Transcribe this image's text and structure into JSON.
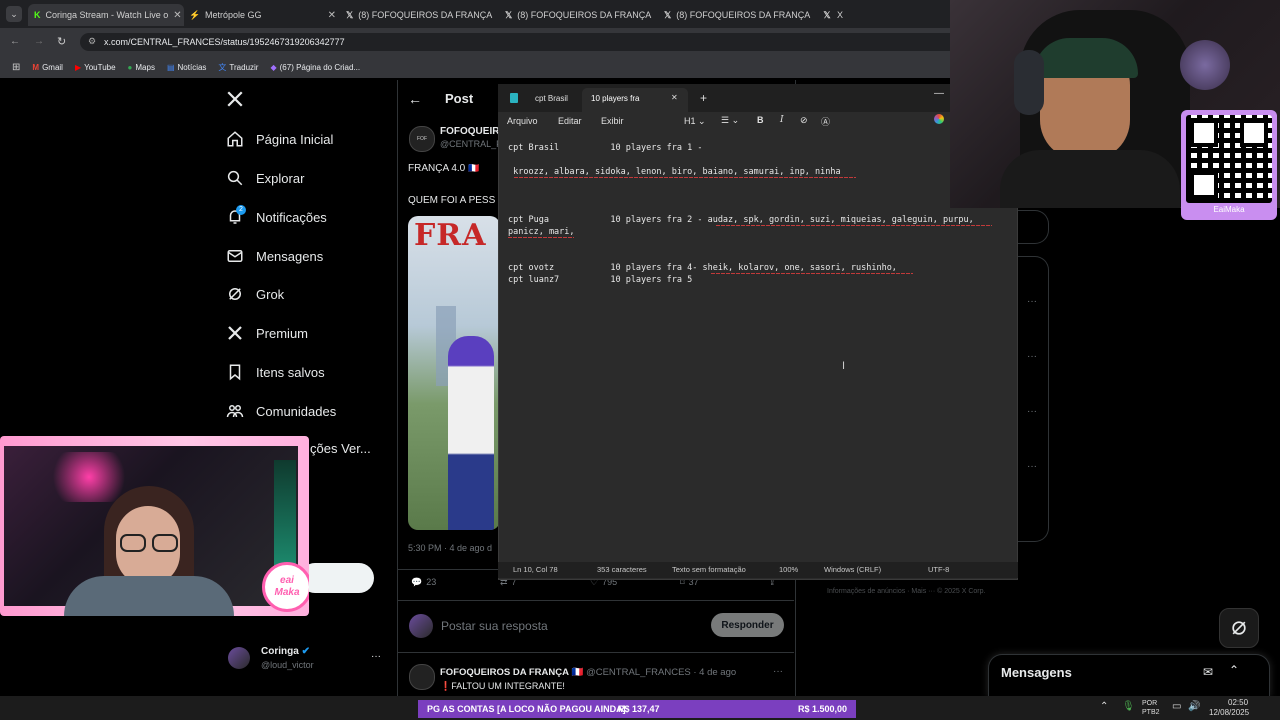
{
  "browser": {
    "tabs": [
      {
        "label": "Coringa Stream - Watch Live o",
        "fav": "K",
        "color": "#53fc18"
      },
      {
        "label": "Metrópole GG",
        "fav": "⚡",
        "color": "#ffd400"
      },
      {
        "label": "(8) FOFOQUEIROS DA FRANÇA",
        "fav": "X",
        "color": "#ffffff"
      },
      {
        "label": "(8) FOFOQUEIROS DA FRANÇA",
        "fav": "X",
        "color": "#ffffff"
      },
      {
        "label": "(8) FOFOQUEIROS DA FRANÇA",
        "fav": "X",
        "color": "#ffffff"
      },
      {
        "label": "X",
        "fav": "X",
        "color": "#ffffff"
      }
    ],
    "url": "x.com/CENTRAL_FRANCES/status/1952467319206342777",
    "bookmarks": [
      "Gmail",
      "YouTube",
      "Maps",
      "Notícias",
      "Traduzir",
      "(67) Página do Criad..."
    ]
  },
  "x": {
    "nav": [
      {
        "id": "home",
        "label": "Página Inicial"
      },
      {
        "id": "explore",
        "label": "Explorar"
      },
      {
        "id": "notifications",
        "label": "Notificações"
      },
      {
        "id": "messages",
        "label": "Mensagens"
      },
      {
        "id": "grok",
        "label": "Grok"
      },
      {
        "id": "premium",
        "label": "Premium"
      },
      {
        "id": "bookmarks",
        "label": "Itens salvos"
      },
      {
        "id": "communities",
        "label": "Comunidades"
      },
      {
        "id": "verified",
        "label": "ções Ver..."
      }
    ],
    "notif_badge": "2",
    "header": "Post",
    "author_name": "FOFOQUEIRO",
    "author_handle": "@CENTRAL_F",
    "tweet_line1": "FRANÇA 4.0",
    "tweet_line2": "QUEM FOI A PESS",
    "image_text": "FRA",
    "time": "5:30 PM · 4 de ago d",
    "stats": {
      "replies": "23",
      "retweets": "7",
      "likes": "795",
      "bookmarks": "37"
    },
    "reply_placeholder": "Postar sua resposta",
    "reply_button": "Responder",
    "account_name": "Coringa",
    "account_handle": "@loud_victor",
    "next_author": "FOFOQUEIROS DA FRANÇA",
    "next_handle": "@CENTRAL_FRANCES · 4 de ago",
    "next_text": "FALTOU UM INTEGRANTE!",
    "messages_label": "Mensagens",
    "footer": "Informações de anúncios  ·  Mais ···  © 2025 X Corp."
  },
  "notepad": {
    "tab1": "cpt Brasil",
    "tab2": "10 players fra",
    "menu": [
      "Arquivo",
      "Editar",
      "Exibir"
    ],
    "heading": "H1",
    "lines": {
      "l1": "cpt Brasil          10 players fra 1 -",
      "l2": " kroozz, albara, sidoka, lenon, biro, baiano, samurai, inp, ninha",
      "l3": "cpt Puga            10 players fra 2 - audaz, spk, gordin, suzi, miqueias, galeguin, purpu,",
      "l4": "panicz, mari,",
      "l5": "cpt ovotz           10 players fra 4- sheik, kolarov, one, sasori, rushinho,",
      "l6": "cpt luanz7          10 players fra 5"
    },
    "status": {
      "pos": "Ln 10, Col 78",
      "chars": "353 caracteres",
      "format": "Texto sem formatação",
      "zoom": "100%",
      "eol": "Windows (CRLF)",
      "enc": "UTF-8"
    }
  },
  "stream": {
    "qr_label": "EaiMaka",
    "logo_text": "eai\nMaka",
    "ticker_left": "PG AS CONTAS [A LOCO NÃO PAGOU AINDA]",
    "ticker_mid": "R$ 137,47",
    "ticker_right": "R$ 1.500,00"
  },
  "taskbar": {
    "lang": "POR\nPTB2",
    "time": "02:50",
    "date": "12/08/2025"
  },
  "colors": {
    "x_bg": "#000000",
    "x_blue": "#1d9bf0",
    "notepad_bg": "#2b2b2b",
    "ticker": "#7b3fbf",
    "accent_pink": "#ff4fa3"
  }
}
